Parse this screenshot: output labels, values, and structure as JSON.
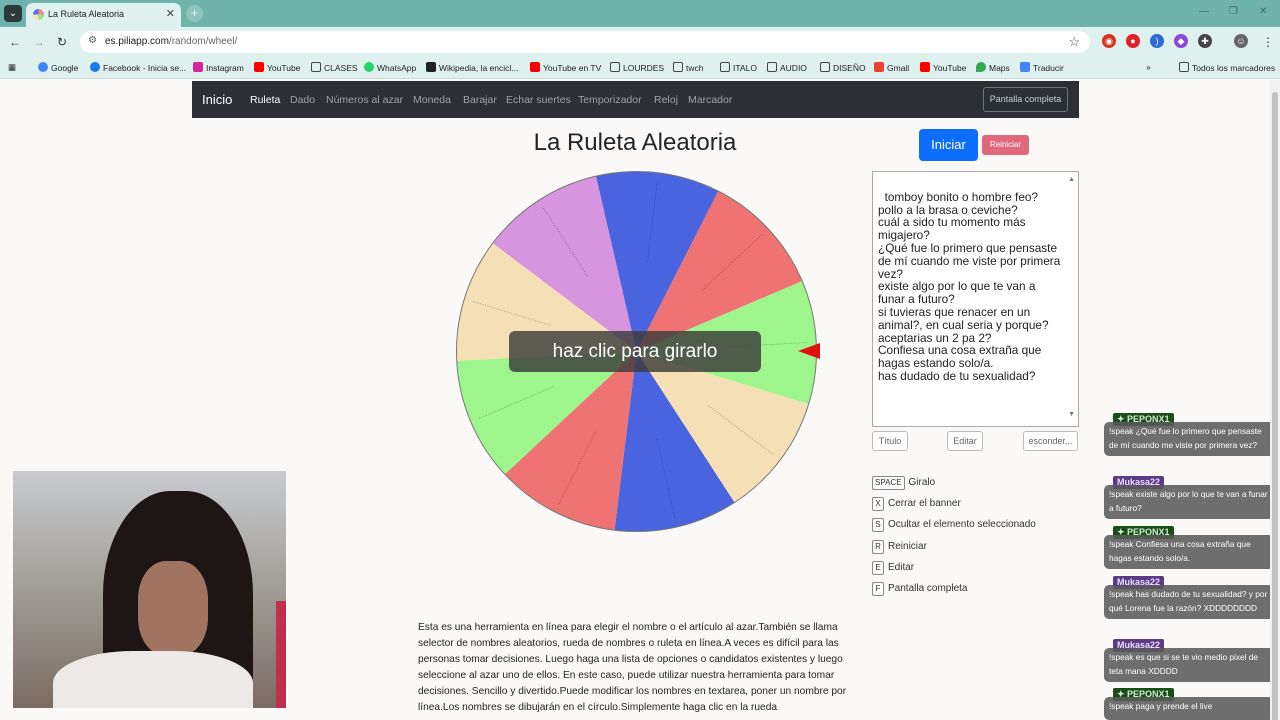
{
  "browser": {
    "tab_title": "La Ruleta Aleatoria",
    "url_host": "es.piliapp.com",
    "url_path": "/random/wheel/",
    "bookmarks": [
      "Google",
      "Facebook - Inicia se...",
      "Instagram",
      "YouTube",
      "CLASES",
      "WhatsApp",
      "Wikipedia, la encicl...",
      "YouTube en TV",
      "LOURDES",
      "twch",
      "ITALO",
      "AUDIO",
      "DISEÑO",
      "Gmail",
      "YouTube",
      "Maps",
      "Traducir"
    ],
    "all_bookmarks": "Todos los marcadores"
  },
  "navbar": {
    "brand": "Inicio",
    "links": [
      "Ruleta",
      "Dado",
      "Números al azar",
      "Moneda",
      "Barajar",
      "Echar suertes",
      "Temporizador",
      "Reloj",
      "Marcador"
    ],
    "fullscreen": "Pantalla completa"
  },
  "page": {
    "title": "La Ruleta Aleatoria",
    "spin_banner": "haz clic para girarlo",
    "start": "Iniciar",
    "reset": "Reiniciar",
    "options_text": "tomboy bonito o hombre feo?\npollo a la brasa o ceviche?\ncuál a sido tu momento más migajero?\n¿Qué fue lo primero que pensaste de mí cuando me viste por primera vez?\nexiste algo por lo que te van a funar a futuro?\nsi tuvieras que renacer en un animal?, en cual seria y porque?\naceptarias un 2 pa 2?\nConfiesa una cosa extraña que hagas estando solo/a.\nhas dudado de tu sexualidad?",
    "title_btn": "Título",
    "edit_btn": "Editar",
    "hide_btn": "esconder...",
    "shortcuts": [
      {
        "key": "SPACE",
        "label": "Giralo"
      },
      {
        "key": "X",
        "label": "Cerrar el banner"
      },
      {
        "key": "S",
        "label": "Ocultar el elemento seleccionado"
      },
      {
        "key": "R",
        "label": "Reiniciar"
      },
      {
        "key": "E",
        "label": "Editar"
      },
      {
        "key": "F",
        "label": "Pantalla completa"
      }
    ],
    "description": "Esta es una herramienta en línea para elegir el nombre o el artículo al azar.También se llama selector de nombres aleatorios, rueda de nombres o ruleta en línea.A veces es difícil para las personas tomar decisiones. Luego haga una lista de opciones o candidatos existentes y luego seleccione al azar uno de ellos. En este caso, puede utilizar nuestra herramienta para tomar decisiones. Sencillo y divertido.Puede modificar los nombres en textarea, poner un nombre por línea.Los nombres se dibujarán en el círculo.Simplemente haga clic en la rueda"
  },
  "wheel": {
    "colors": [
      "#f07373",
      "#9ef58c",
      "#f5e0b5",
      "#4a64e0",
      "#f07373",
      "#9ef58c",
      "#f5e0b5",
      "#d794df",
      "#4a64e0"
    ]
  },
  "chat": [
    {
      "user": "PEPONX1",
      "message": "!speak ¿Qué fue lo primero que pensaste de mí cuando me viste por primera vez?"
    },
    {
      "user": "Mukasa22",
      "message": "!speak existe algo por lo que te van a funar a futuro?"
    },
    {
      "user": "PEPONX1",
      "message": "!speak Confiesa una cosa extraña que hagas estando solo/a."
    },
    {
      "user": "Mukasa22",
      "message": "!speak has dudado de tu sexualidad? y por qué Lorena fue la razón? XDDDDDDDD"
    },
    {
      "user": "Mukasa22",
      "message": "!speak es que si se te vio medio pixel de teta mana XDDDD"
    },
    {
      "user": "PEPONX1",
      "message": "!speak paga y prende el live"
    }
  ]
}
